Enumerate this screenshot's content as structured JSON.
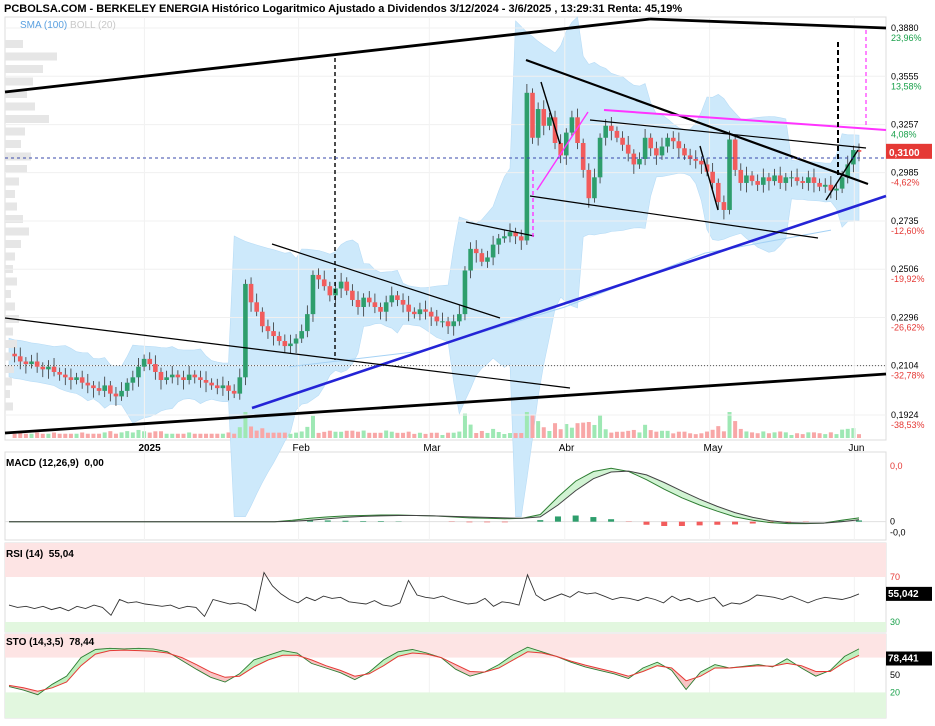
{
  "header": {
    "site": "PCBOLSA.COM",
    "sep": " - ",
    "title": "BERKELEY ENERGIA Histórico Logaritmico Ajustado a Dividendos 3/12/2024 - 3/6/2025 , 13:29:31 Renta: 45,19%"
  },
  "legend": {
    "sma": "SMA (100)",
    "boll": "BOLL (20)"
  },
  "colors": {
    "up": "#2e9e6c",
    "down": "#f25c5c",
    "band": "#cde9fb",
    "sma": "#a5d2f5",
    "trend_black": "#000000",
    "trend_blue": "#2424d6",
    "magenta": "#ff33ff",
    "current": "#e53935",
    "volume_up": "#9ee8b4",
    "volume_down": "#f8a7a7",
    "pct_pos": "#19a04a",
    "pct_neg": "#e53935"
  },
  "chart_data": [
    {
      "type": "candlestick",
      "name": "price",
      "scale": "log",
      "ylim": [
        0.186,
        0.392
      ],
      "x_tick_labels": [
        "2025",
        "Feb",
        "Mar",
        "Abr",
        "May",
        "Jun"
      ],
      "x_tick_dates": [
        "2025-01-01",
        "2025-02-03",
        "2025-03-03",
        "2025-04-01",
        "2025-05-02",
        "2025-06-02"
      ],
      "price_levels": [
        {
          "price": "0,3880",
          "pct": "23,96%"
        },
        {
          "price": "0,3555",
          "pct": "13,58%"
        },
        {
          "price": "0,3257",
          "pct": "4,08%"
        },
        {
          "price": "0,2985",
          "pct": "-4,62%"
        },
        {
          "price": "0,2735",
          "pct": "-12,60%"
        },
        {
          "price": "0,2506",
          "pct": "-19,92%"
        },
        {
          "price": "0,2296",
          "pct": "-26,62%"
        },
        {
          "price": "0,2104",
          "pct": "-32,78%"
        },
        {
          "price": "0,1924",
          "pct": "-38,53%"
        }
      ],
      "current_price": "0,3100",
      "close_series": [
        0.215,
        0.214,
        0.212,
        0.211,
        0.212,
        0.21,
        0.209,
        0.21,
        0.208,
        0.207,
        0.206,
        0.205,
        0.206,
        0.204,
        0.203,
        0.202,
        0.201,
        0.203,
        0.2,
        0.199,
        0.201,
        0.204,
        0.206,
        0.21,
        0.213,
        0.211,
        0.208,
        0.205,
        0.206,
        0.207,
        0.206,
        0.205,
        0.207,
        0.206,
        0.205,
        0.204,
        0.203,
        0.202,
        0.203,
        0.201,
        0.2,
        0.206,
        0.244,
        0.236,
        0.232,
        0.226,
        0.224,
        0.222,
        0.22,
        0.218,
        0.219,
        0.221,
        0.224,
        0.231,
        0.248,
        0.246,
        0.243,
        0.239,
        0.242,
        0.245,
        0.241,
        0.237,
        0.234,
        0.238,
        0.236,
        0.234,
        0.232,
        0.236,
        0.239,
        0.237,
        0.235,
        0.232,
        0.231,
        0.233,
        0.232,
        0.23,
        0.228,
        0.228,
        0.226,
        0.228,
        0.231,
        0.25,
        0.26,
        0.258,
        0.254,
        0.256,
        0.262,
        0.265,
        0.266,
        0.268,
        0.266,
        0.264,
        0.345,
        0.318,
        0.335,
        0.325,
        0.33,
        0.315,
        0.308,
        0.321,
        0.33,
        0.315,
        0.3,
        0.285,
        0.296,
        0.318,
        0.325,
        0.322,
        0.318,
        0.314,
        0.309,
        0.303,
        0.306,
        0.318,
        0.312,
        0.308,
        0.313,
        0.318,
        0.316,
        0.312,
        0.308,
        0.306,
        0.305,
        0.303,
        0.299,
        0.293,
        0.283,
        0.279,
        0.317,
        0.3,
        0.293,
        0.297,
        0.294,
        0.292,
        0.296,
        0.294,
        0.297,
        0.293,
        0.296,
        0.296,
        0.294,
        0.293,
        0.296,
        0.293,
        0.291,
        0.292,
        0.289,
        0.29,
        0.296,
        0.303,
        0.311,
        0.31
      ],
      "sma_100": [
        {
          "date": "2025-02-01",
          "price": 0.21
        },
        {
          "date": "2025-03-01",
          "price": 0.216
        },
        {
          "date": "2025-04-01",
          "price": 0.234
        },
        {
          "date": "2025-05-01",
          "price": 0.258
        },
        {
          "date": "2025-05-28",
          "price": 0.269
        }
      ]
    },
    {
      "type": "volume",
      "name": "volume",
      "note": "small bars at bottom of price panel"
    },
    {
      "type": "line",
      "name": "MACD (12,26,9)",
      "value": "0,00",
      "y_tick_labels": [
        "0,0",
        "0",
        "-0,0"
      ],
      "macd": [
        0,
        0,
        0,
        0,
        0,
        0,
        0,
        0,
        0,
        0,
        0,
        0,
        0,
        0,
        0,
        0,
        0.0003,
        0.0007,
        0.001,
        0.0012,
        0.0013,
        0.0014,
        0.0014,
        0.0013,
        0.0012,
        0.001,
        0.0008,
        0.0007,
        0.0006,
        0.0007,
        0.0015,
        0.0052,
        0.0085,
        0.0105,
        0.0112,
        0.0105,
        0.0088,
        0.0068,
        0.005,
        0.0035,
        0.0022,
        0.001,
        0.0003,
        -0.0002,
        -0.0004,
        -0.0004,
        -0.0003,
        0.0003,
        0.0008
      ],
      "signal": [
        0,
        0,
        0,
        0,
        0,
        0,
        0,
        0,
        0,
        0,
        0,
        0,
        0,
        0,
        0,
        0,
        0.0001,
        0.0003,
        0.0006,
        0.0009,
        0.0011,
        0.0012,
        0.0013,
        0.0013,
        0.0012,
        0.0011,
        0.001,
        0.0009,
        0.0008,
        0.0007,
        0.001,
        0.0035,
        0.0065,
        0.009,
        0.0104,
        0.0106,
        0.0098,
        0.0082,
        0.0064,
        0.0047,
        0.0032,
        0.0019,
        0.0009,
        0.0002,
        -0.0002,
        -0.0003,
        -0.0003,
        0,
        0.0004
      ]
    },
    {
      "type": "line",
      "name": "RSI (14)",
      "value": "55,04",
      "current": "55,042",
      "levels": [
        70,
        30
      ],
      "y_tick_labels": [
        "70",
        "30"
      ],
      "values": [
        45,
        43,
        44,
        42,
        44,
        41,
        43,
        40,
        44,
        42,
        45,
        43,
        36,
        50,
        47,
        48,
        46,
        45,
        44,
        45,
        42,
        44,
        43,
        35,
        50,
        48,
        46,
        47,
        45,
        40,
        74,
        62,
        55,
        50,
        47,
        52,
        49,
        53,
        51,
        52,
        48,
        47,
        46,
        49,
        45,
        44,
        47,
        67,
        54,
        52,
        51,
        53,
        50,
        48,
        46,
        47,
        51,
        44,
        48,
        47,
        45,
        72,
        54,
        49,
        52,
        55,
        52,
        57,
        55,
        56,
        53,
        50,
        52,
        51,
        49,
        52,
        50,
        47,
        53,
        49,
        51,
        48,
        50,
        52,
        44,
        47,
        46,
        49,
        54,
        53,
        52,
        50,
        53,
        50,
        47,
        50,
        52,
        51,
        50,
        52,
        55
      ]
    },
    {
      "type": "line",
      "name": "STO (14,3,5)",
      "value": "78,44",
      "current": "78,441",
      "levels": [
        80,
        50,
        20
      ],
      "y_tick_labels": [
        "50",
        "20"
      ],
      "k": [
        30,
        24,
        16,
        34,
        48,
        80,
        94,
        96,
        95,
        96,
        95,
        90,
        75,
        60,
        46,
        38,
        52,
        76,
        84,
        92,
        88,
        70,
        62,
        54,
        42,
        55,
        76,
        90,
        94,
        88,
        80,
        60,
        48,
        55,
        68,
        85,
        98,
        90,
        82,
        72,
        64,
        58,
        52,
        44,
        62,
        72,
        58,
        25,
        55,
        68,
        62,
        65,
        68,
        64,
        78,
        62,
        48,
        58,
        82,
        95
      ],
      "d": [
        32,
        28,
        22,
        28,
        38,
        66,
        86,
        92,
        93,
        92,
        91,
        88,
        80,
        68,
        55,
        46,
        48,
        64,
        76,
        84,
        84,
        76,
        66,
        58,
        48,
        52,
        66,
        82,
        88,
        86,
        80,
        68,
        56,
        55,
        62,
        76,
        90,
        88,
        82,
        74,
        67,
        61,
        55,
        48,
        56,
        66,
        62,
        40,
        48,
        62,
        62,
        64,
        66,
        65,
        70,
        66,
        56,
        56,
        72,
        84
      ]
    }
  ]
}
